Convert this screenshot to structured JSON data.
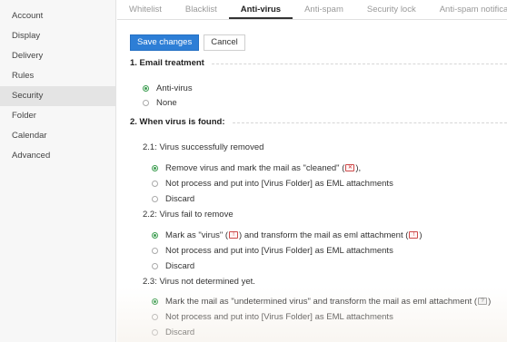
{
  "sidebar": {
    "items": [
      {
        "label": "Account"
      },
      {
        "label": "Display"
      },
      {
        "label": "Delivery"
      },
      {
        "label": "Rules"
      },
      {
        "label": "Security"
      },
      {
        "label": "Folder"
      },
      {
        "label": "Calendar"
      },
      {
        "label": "Advanced"
      }
    ],
    "active": "Security"
  },
  "tabs": [
    {
      "label": "Whitelist"
    },
    {
      "label": "Blacklist"
    },
    {
      "label": "Anti-virus"
    },
    {
      "label": "Anti-spam"
    },
    {
      "label": "Security lock"
    },
    {
      "label": "Anti-spam notification"
    }
  ],
  "active_tab": "Anti-virus",
  "toolbar": {
    "save_label": "Save changes",
    "cancel_label": "Cancel"
  },
  "section1": {
    "title": "1. Email treatment",
    "options": [
      {
        "label": "Anti-virus",
        "checked": true
      },
      {
        "label": "None",
        "checked": false
      }
    ]
  },
  "section2": {
    "title": "2. When virus is found:",
    "sub1": {
      "title": "2.1: Virus successfully removed",
      "opt1_before": "Remove virus and mark the mail as \"cleaned\" (",
      "opt1_after": "),",
      "opt2": "Not process and put into [Virus Folder] as EML attachments",
      "opt3": "Discard"
    },
    "sub2": {
      "title": "2.2: Virus fail to remove",
      "opt1_a": "Mark as \"virus\" (",
      "opt1_b": ") and transform the mail as eml attachment (",
      "opt1_c": ")",
      "opt2": "Not process and put into [Virus Folder] as EML attachments",
      "opt3": "Discard"
    },
    "sub3": {
      "title": "2.3: Virus not determined yet.",
      "opt1_a": "Mark the mail as \"undetermined virus\" and transform the mail as eml attachment (",
      "opt1_b": ")",
      "opt2": "Not process and put into [Virus Folder] as EML attachments",
      "opt3": "Discard"
    }
  },
  "icons": {
    "virus": "virus-icon",
    "undetermined": "undetermined-virus-icon"
  },
  "colors": {
    "primary": "#2d7ed6",
    "radio_checked": "#3e9e52"
  }
}
